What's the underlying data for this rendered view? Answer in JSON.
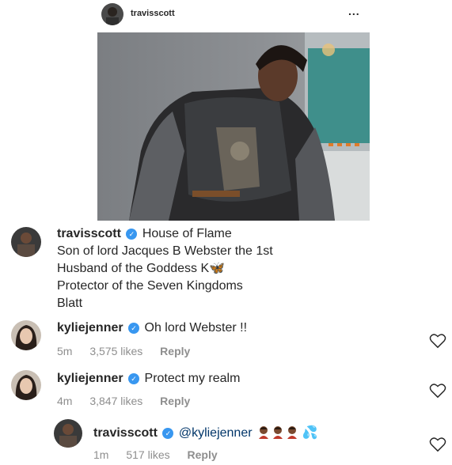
{
  "post": {
    "username": "travisscott",
    "more_label": "..."
  },
  "caption": {
    "username": "travisscott",
    "lines": [
      "House of Flame",
      "Son of lord Jacques B Webster the 1st",
      "Husband of the Goddess K",
      "Protector of the Seven Kingdoms",
      "Blatt"
    ],
    "butterfly": "🦋"
  },
  "comments": [
    {
      "username": "kyliejenner",
      "text": "Oh lord Webster !!",
      "time": "5m",
      "likes": "3,575 likes",
      "reply": "Reply"
    },
    {
      "username": "kyliejenner",
      "text": "Protect my realm",
      "time": "4m",
      "likes": "3,847 likes",
      "reply": "Reply"
    },
    {
      "username": "travisscott",
      "mention": "@kyliejenner",
      "time": "1m",
      "likes": "517 likes",
      "reply": "Reply",
      "splash": "💦"
    }
  ],
  "colors": {
    "verified": "#3897f0",
    "meta": "#8e8e8e",
    "text": "#262626"
  },
  "icons": [
    "verified-badge-icon",
    "heart-icon",
    "more-icon"
  ]
}
